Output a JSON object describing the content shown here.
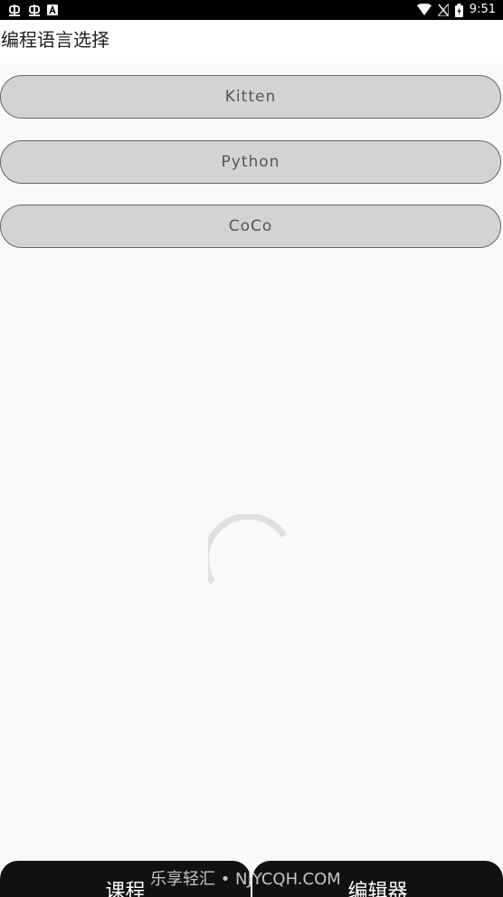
{
  "status_bar": {
    "time": "9:51",
    "left_icons": [
      "bug-icon",
      "bug-icon",
      "a-badge-icon"
    ],
    "right_icons": [
      "wifi-icon",
      "no-signal-icon",
      "battery-icon"
    ]
  },
  "header": {
    "title": "编程语言选择"
  },
  "languages": [
    {
      "label": "Kitten"
    },
    {
      "label": "Python"
    },
    {
      "label": "CoCo"
    }
  ],
  "bottom_nav": {
    "tabs": [
      {
        "label": "课程"
      },
      {
        "label": "编辑器"
      }
    ]
  },
  "watermark": "乐享轻汇 • NJYCQH.COM",
  "colors": {
    "status_bar_bg": "#000000",
    "page_bg": "#f9f9f9",
    "button_bg": "#d3d3d3",
    "button_border": "#666666",
    "button_text": "#555555",
    "spinner": "#e0e0e0",
    "bottom_nav_bg": "#111111"
  }
}
